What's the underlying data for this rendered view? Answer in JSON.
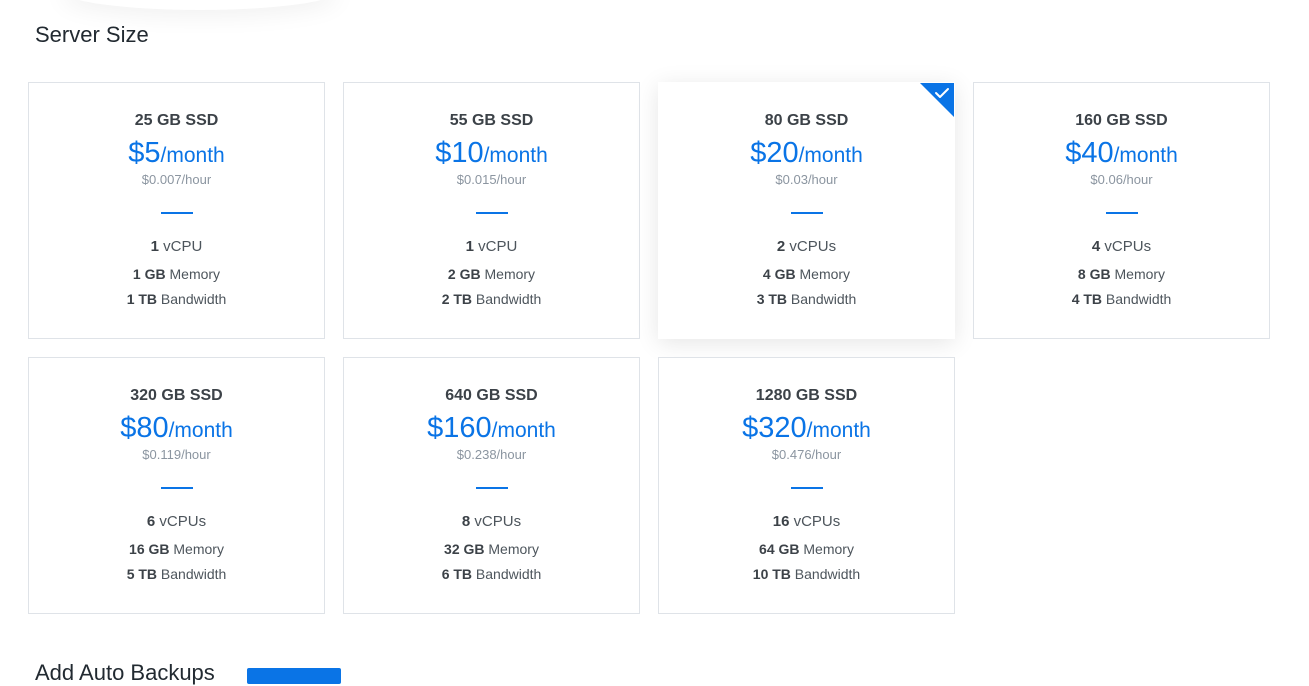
{
  "section_title": "Server Size",
  "next_section_title": "Add Auto Backups",
  "accent_color": "#0a74e6",
  "selected_plan": "80 GB SSD",
  "plans": [
    {
      "disk": "25 GB SSD",
      "price": "$5",
      "per": "/month",
      "hourly": "$0.007/hour",
      "cpu_num": "1",
      "cpu_unit": " vCPU",
      "mem_num": "1 GB",
      "mem_unit": " Memory",
      "bw_num": "1 TB",
      "bw_unit": " Bandwidth"
    },
    {
      "disk": "55 GB SSD",
      "price": "$10",
      "per": "/month",
      "hourly": "$0.015/hour",
      "cpu_num": "1",
      "cpu_unit": " vCPU",
      "mem_num": "2 GB",
      "mem_unit": " Memory",
      "bw_num": "2 TB",
      "bw_unit": " Bandwidth"
    },
    {
      "disk": "80 GB SSD",
      "price": "$20",
      "per": "/month",
      "hourly": "$0.03/hour",
      "cpu_num": "2",
      "cpu_unit": " vCPUs",
      "mem_num": "4 GB",
      "mem_unit": " Memory",
      "bw_num": "3 TB",
      "bw_unit": " Bandwidth"
    },
    {
      "disk": "160 GB SSD",
      "price": "$40",
      "per": "/month",
      "hourly": "$0.06/hour",
      "cpu_num": "4",
      "cpu_unit": " vCPUs",
      "mem_num": "8 GB",
      "mem_unit": " Memory",
      "bw_num": "4 TB",
      "bw_unit": " Bandwidth"
    },
    {
      "disk": "320 GB SSD",
      "price": "$80",
      "per": "/month",
      "hourly": "$0.119/hour",
      "cpu_num": "6",
      "cpu_unit": " vCPUs",
      "mem_num": "16 GB",
      "mem_unit": " Memory",
      "bw_num": "5 TB",
      "bw_unit": " Bandwidth"
    },
    {
      "disk": "640 GB SSD",
      "price": "$160",
      "per": "/month",
      "hourly": "$0.238/hour",
      "cpu_num": "8",
      "cpu_unit": " vCPUs",
      "mem_num": "32 GB",
      "mem_unit": " Memory",
      "bw_num": "6 TB",
      "bw_unit": " Bandwidth"
    },
    {
      "disk": "1280 GB SSD",
      "price": "$320",
      "per": "/month",
      "hourly": "$0.476/hour",
      "cpu_num": "16",
      "cpu_unit": " vCPUs",
      "mem_num": "64 GB",
      "mem_unit": " Memory",
      "bw_num": "10 TB",
      "bw_unit": " Bandwidth"
    }
  ]
}
